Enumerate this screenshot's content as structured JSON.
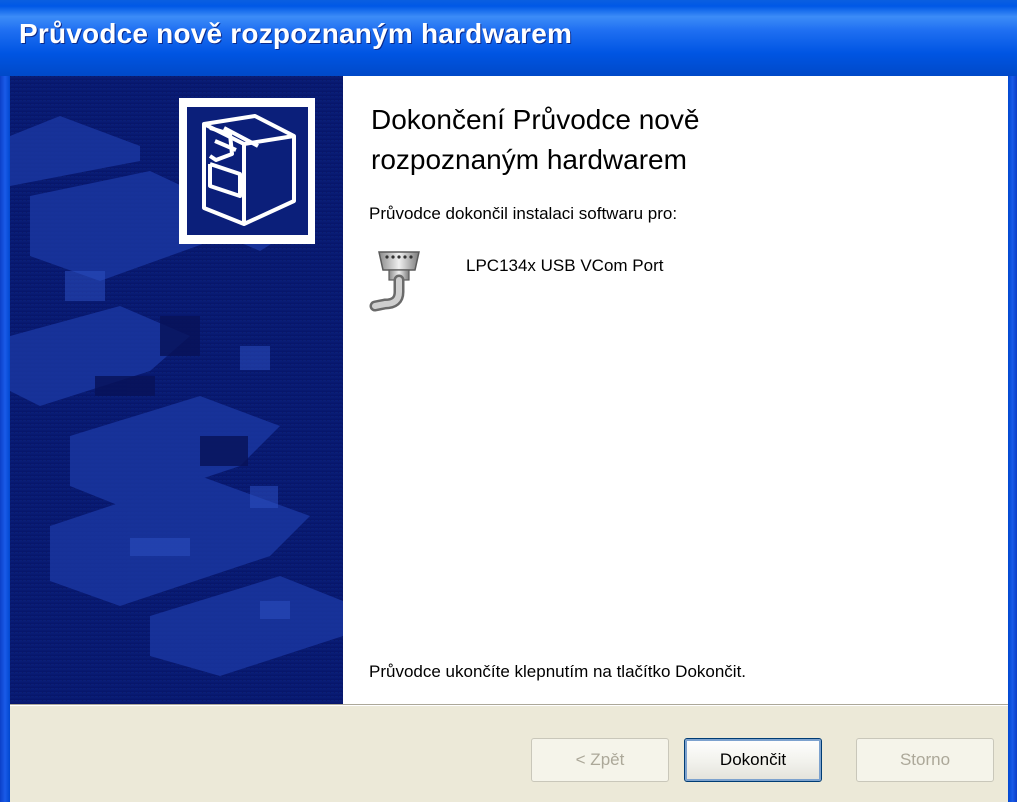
{
  "window": {
    "title": "Průvodce nově rozpoznaným hardwarem"
  },
  "content": {
    "heading_line1": "Dokončení Průvodce nově",
    "heading_line2": "rozpoznaným hardwarem",
    "subtext": "Průvodce dokončil instalaci softwaru pro:",
    "device_name": "LPC134x USB VCom Port",
    "device_icon": "serial-port-icon",
    "footer_text": "Průvodce ukončíte klepnutím na tlačítko Dokončit."
  },
  "buttons": {
    "back_label": "< Zpět",
    "finish_label": "Dokončit",
    "cancel_label": "Storno"
  },
  "colors": {
    "titlebar": "#0058e6",
    "side_panel": "#0a1a6b",
    "button_bar": "#ece9d8"
  }
}
